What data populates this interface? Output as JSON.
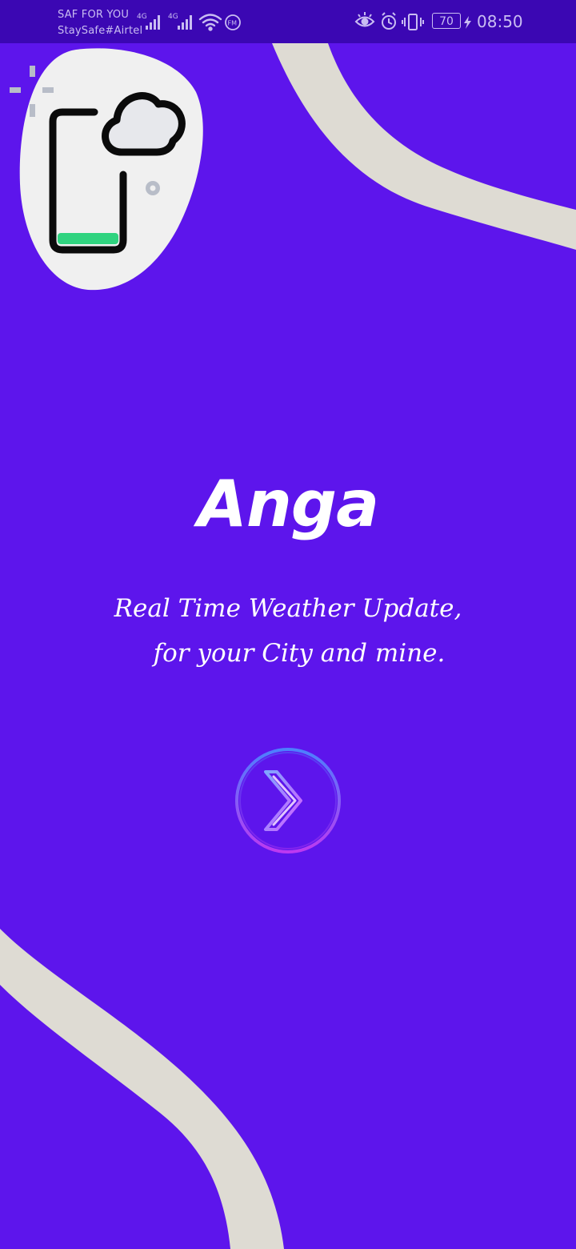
{
  "status_bar": {
    "carrier_line1": "SAF FOR YOU",
    "carrier_line2": "StaySafe#Airtel",
    "network1": "4G",
    "network2": "4G",
    "battery": "70",
    "time": "08:50",
    "icons": [
      "signal-icon",
      "wifi-icon",
      "fm-radio-icon",
      "eye-comfort-icon",
      "alarm-icon",
      "vibrate-icon",
      "battery-icon",
      "charging-icon"
    ]
  },
  "splash": {
    "logo_icon": "phone-cloud-icon",
    "title": "Anga",
    "tagline_line1": "Real Time Weather Update,",
    "tagline_line2": "for your City and mine.",
    "next_icon": "chevron-right-icon"
  },
  "colors": {
    "background": "#5d15ec",
    "status_bar": "#3b07b3",
    "wave": "#dedbd3",
    "blob": "#f0f0f0",
    "phone_screen_accent": "#2fd37f",
    "button_gradient_start": "#4a8cff",
    "button_gradient_end": "#c83df0"
  }
}
